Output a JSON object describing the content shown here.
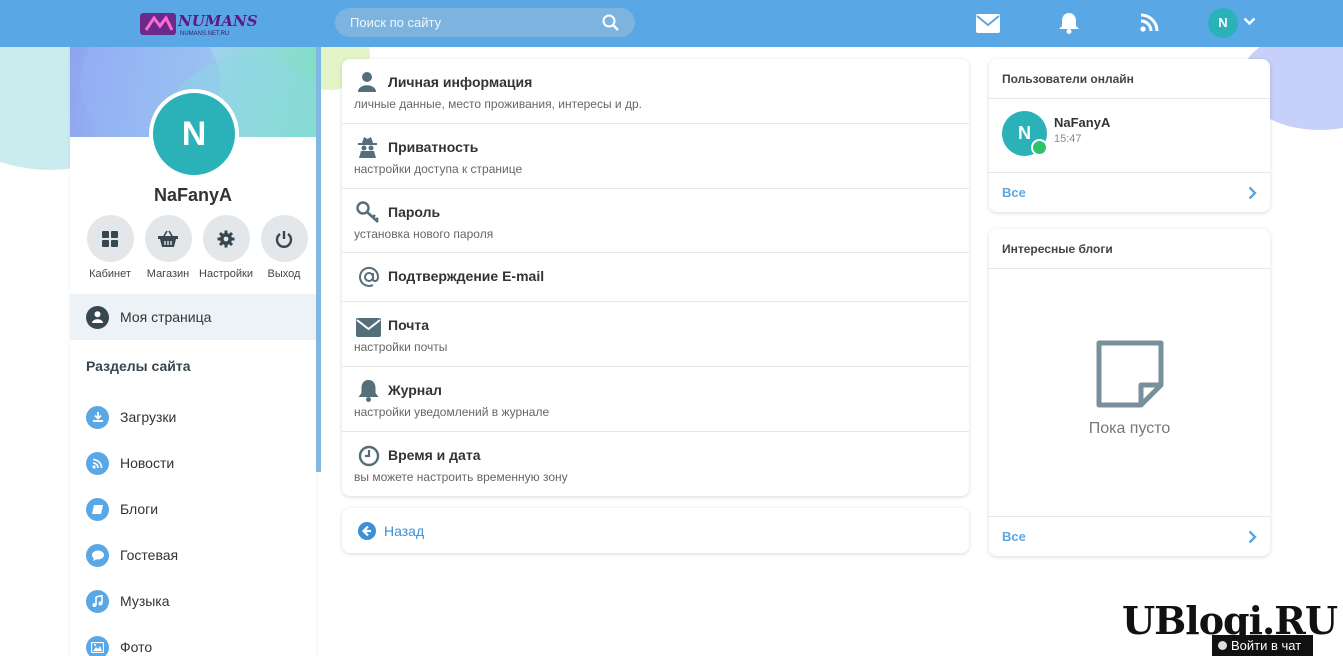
{
  "header": {
    "logo_text": "NUMANS",
    "logo_subtext": "NUMANS.NET.RU",
    "search_placeholder": "Поиск по сайту",
    "avatar_letter": "N"
  },
  "sidebar": {
    "avatar_letter": "N",
    "user_name": "NaFanyA",
    "quick_buttons": [
      {
        "label": "Кабинет",
        "icon": "grid-icon"
      },
      {
        "label": "Магазин",
        "icon": "basket-icon"
      },
      {
        "label": "Настройки",
        "icon": "gear-icon"
      },
      {
        "label": "Выход",
        "icon": "power-icon"
      }
    ],
    "my_page": "Моя страница",
    "sections_title": "Разделы сайта",
    "items": [
      {
        "label": "Загрузки",
        "icon": "download-icon"
      },
      {
        "label": "Новости",
        "icon": "rss-icon"
      },
      {
        "label": "Блоги",
        "icon": "book-icon"
      },
      {
        "label": "Гостевая",
        "icon": "chat-bubble-icon"
      },
      {
        "label": "Музыка",
        "icon": "music-note-icon"
      },
      {
        "label": "Фото",
        "icon": "photo-icon"
      }
    ]
  },
  "settings": {
    "items": [
      {
        "title": "Личная информация",
        "subtitle": "личные данные, место проживания, интересы и др.",
        "icon": "user-icon"
      },
      {
        "title": "Приватность",
        "subtitle": "настройки доступа к странице",
        "icon": "spy-icon"
      },
      {
        "title": "Пароль",
        "subtitle": "установка нового пароля",
        "icon": "key-icon"
      },
      {
        "title": "Подтверждение E-mail",
        "subtitle": "",
        "icon": "at-icon"
      },
      {
        "title": "Почта",
        "subtitle": "настройки почты",
        "icon": "envelope-icon"
      },
      {
        "title": "Журнал",
        "subtitle": "настройки уведомлений в журнале",
        "icon": "bell-icon"
      },
      {
        "title": "Время и дата",
        "subtitle": "вы можете настроить временную зону",
        "icon": "clock-icon"
      }
    ],
    "back_label": "Назад"
  },
  "online": {
    "title": "Пользователи онлайн",
    "user": {
      "letter": "N",
      "name": "NaFanyA",
      "time": "15:47"
    },
    "all_label": "Все"
  },
  "blogs": {
    "title": "Интересные блоги",
    "empty_text": "Пока пусто",
    "all_label": "Все"
  },
  "watermark": "UBlogi.RU",
  "chat_button": "Войти в чат",
  "colors": {
    "topbar": "#5aa7e5",
    "avatar": "#2bb2b8",
    "link": "#3d8fd8",
    "online": "#2ec36b"
  }
}
